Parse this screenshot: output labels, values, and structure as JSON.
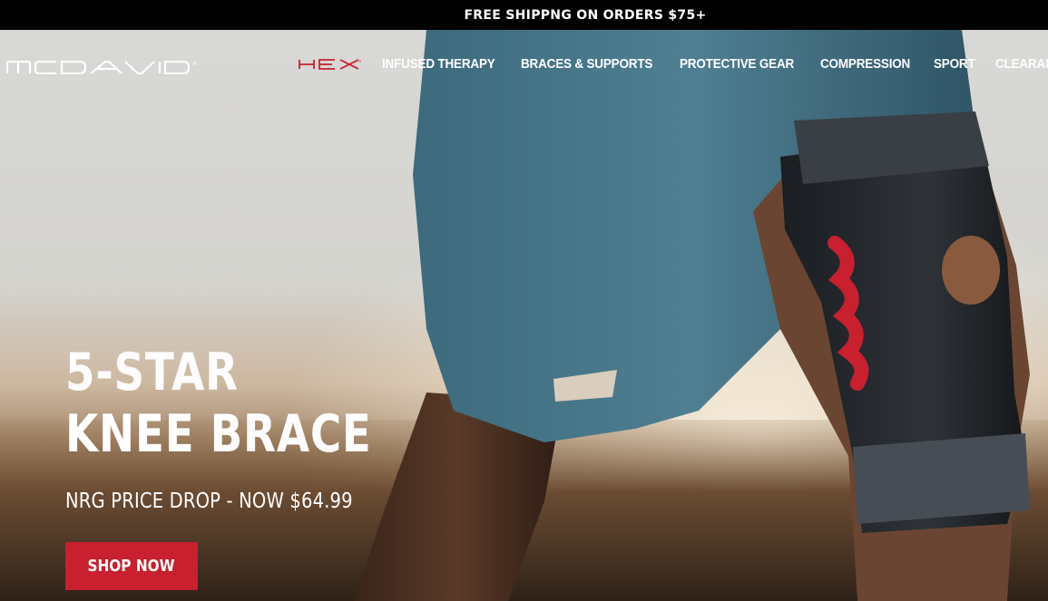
{
  "announcement": {
    "text": "FREE SHIPPNG ON ORDERS $75+"
  },
  "brand": {
    "logo_name": "MCDAVID",
    "sub_brand": "HEX",
    "accent": "#c8202f"
  },
  "nav": {
    "items": [
      {
        "label": "INFUSED THERAPY"
      },
      {
        "label": "BRACES & SUPPORTS"
      },
      {
        "label": "PROTECTIVE GEAR"
      },
      {
        "label": "COMPRESSION"
      },
      {
        "label": "SPORT"
      },
      {
        "label": "CLEARANCE"
      }
    ]
  },
  "hero": {
    "headline_line1": "5-STAR",
    "headline_line2": "KNEE BRACE",
    "subheadline": "NRG PRICE DROP - NOW $64.99",
    "cta_label": "SHOP NOW"
  }
}
